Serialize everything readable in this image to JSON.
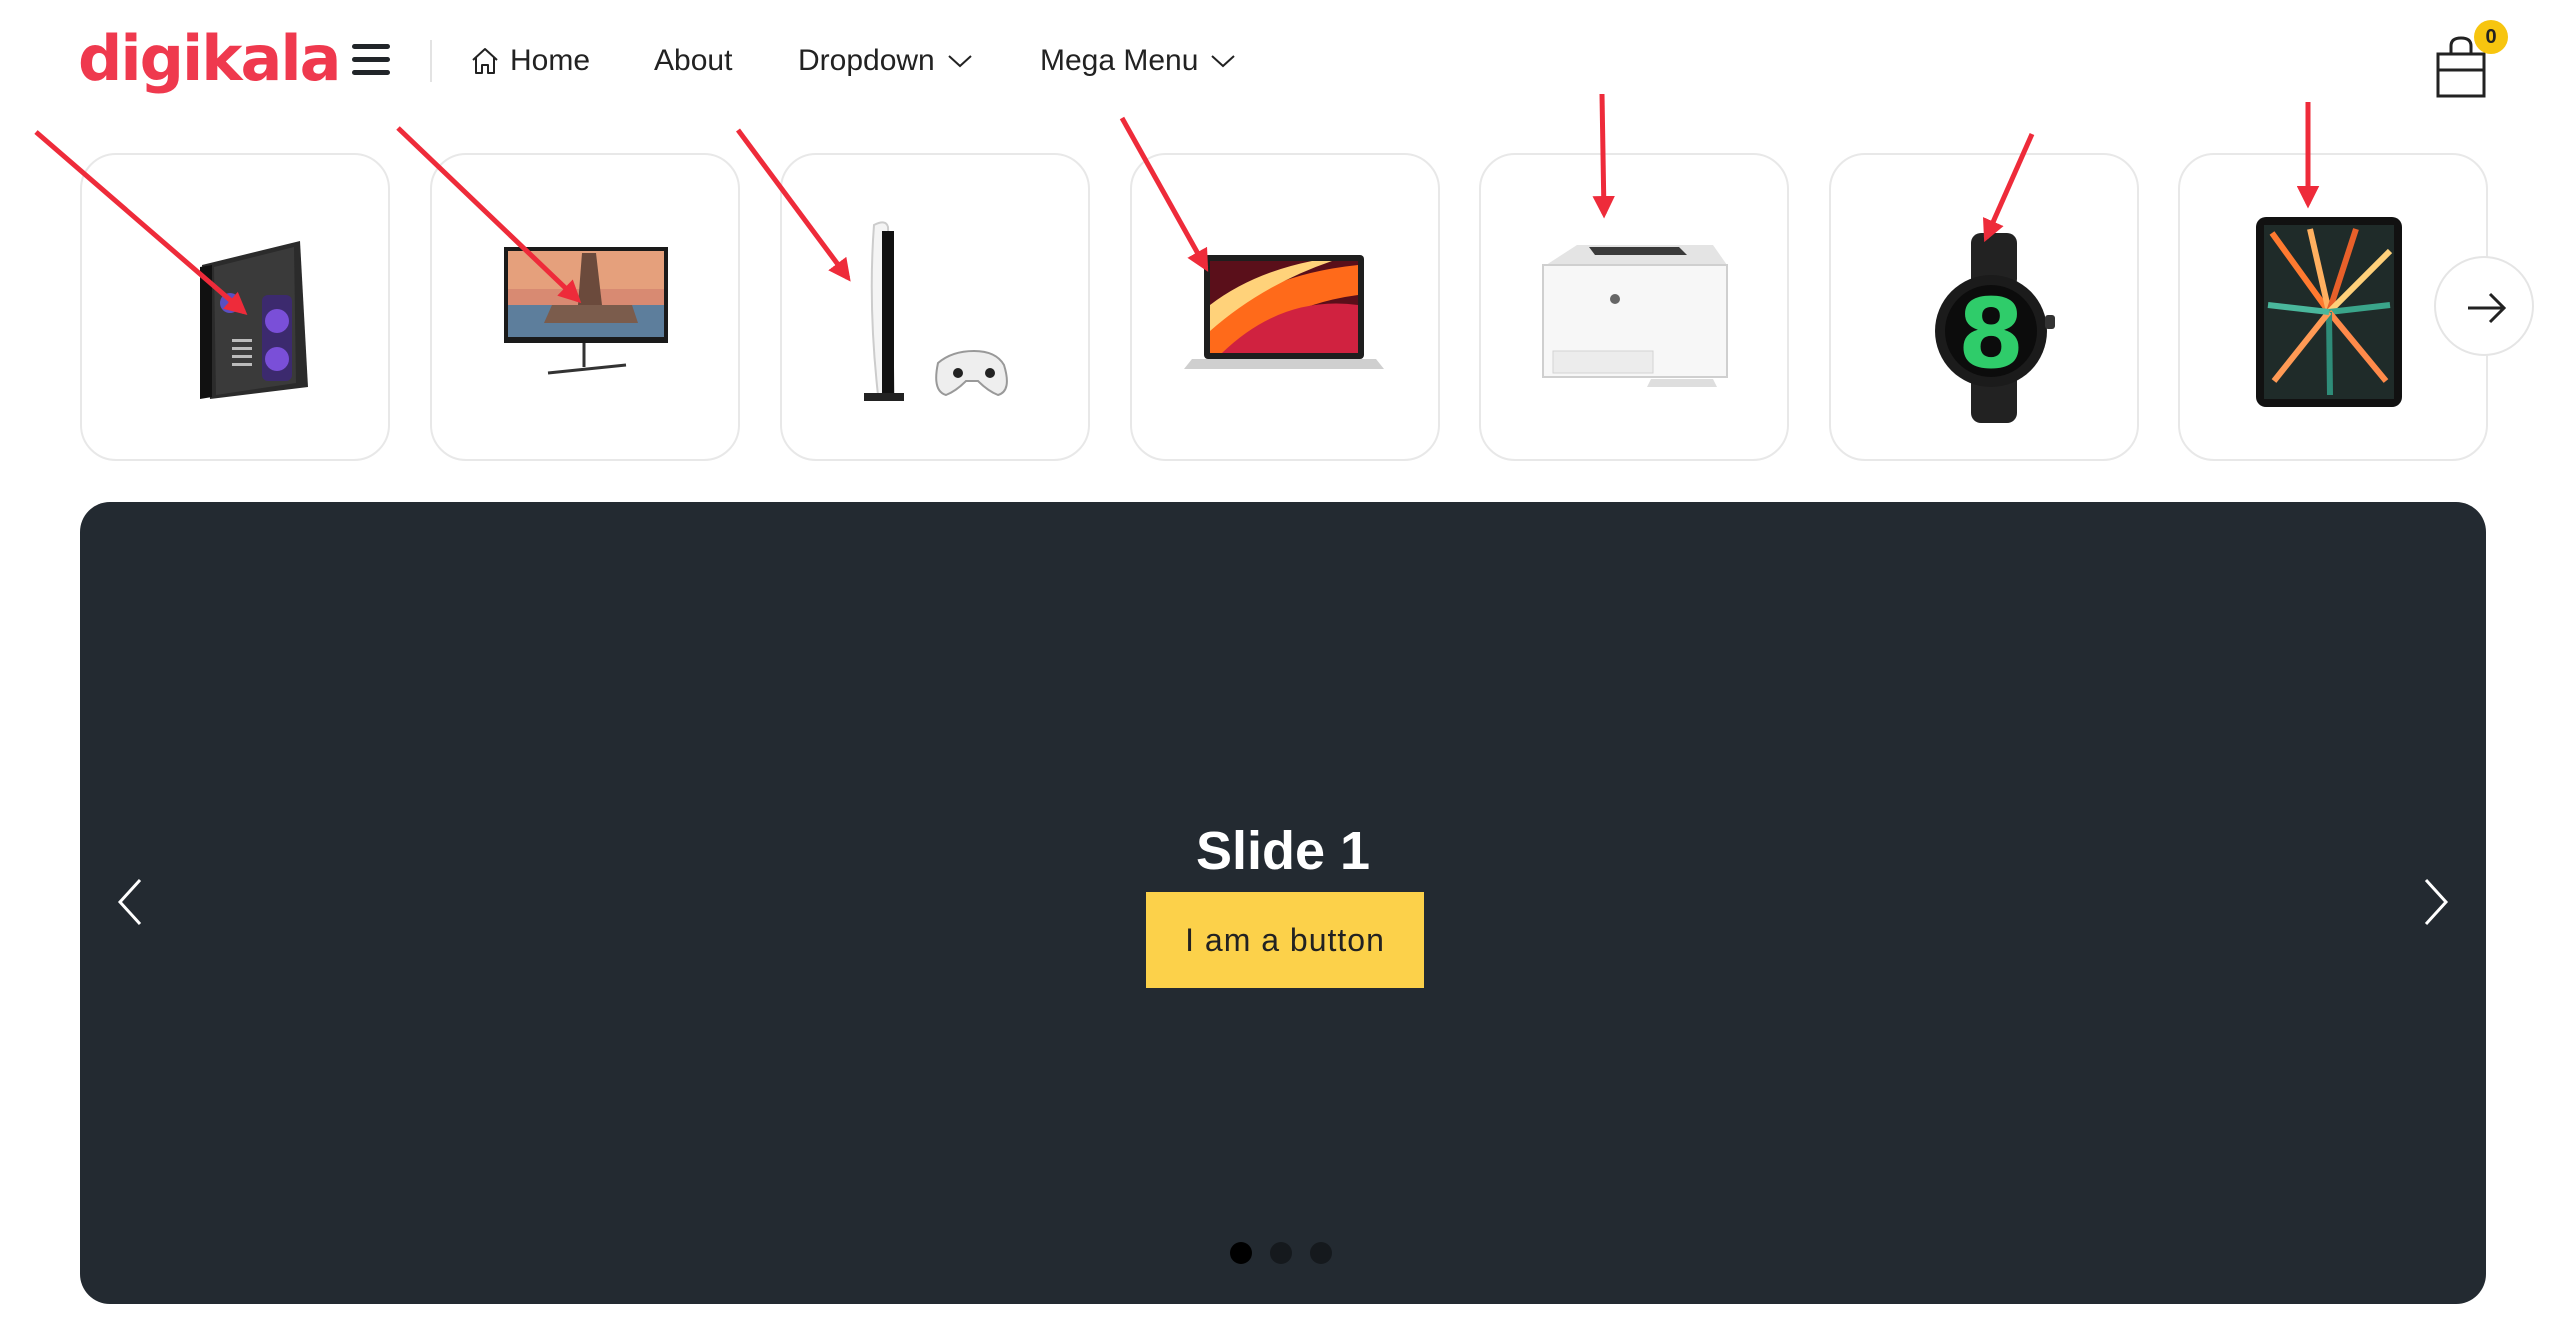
{
  "brand": {
    "logo_text": "digikala",
    "color": "#ef394e"
  },
  "header": {
    "menu_icon": "hamburger-icon",
    "nav": {
      "home": "Home",
      "about": "About",
      "dropdown": "Dropdown",
      "mega_menu": "Mega Menu"
    },
    "cart": {
      "icon": "shopping-bag-icon",
      "count": "0",
      "badge_color": "#f7c50f"
    }
  },
  "categories": [
    {
      "name": "desktop-pc",
      "icon": "pc-case-icon"
    },
    {
      "name": "monitor",
      "icon": "monitor-icon"
    },
    {
      "name": "game-console",
      "icon": "console-icon"
    },
    {
      "name": "laptop",
      "icon": "laptop-icon"
    },
    {
      "name": "printer",
      "icon": "printer-icon"
    },
    {
      "name": "smartwatch",
      "icon": "watch-icon"
    },
    {
      "name": "tablet",
      "icon": "tablet-icon"
    }
  ],
  "strip_next_icon": "arrow-right-icon",
  "hero": {
    "background": "#232a31",
    "slide_title": "Slide 1",
    "button_label": "I am a button",
    "button_color": "#fcd14a",
    "active_slide": 1,
    "slide_count": 3
  },
  "annotation_color": "#ee2b3a"
}
